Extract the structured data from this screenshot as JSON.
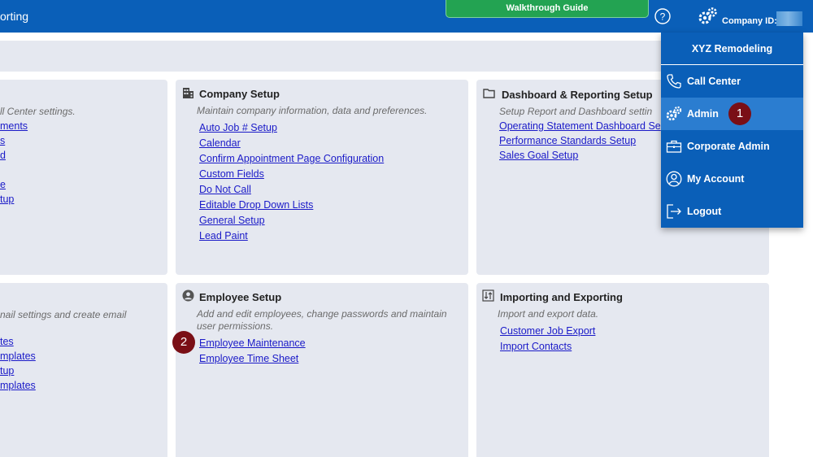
{
  "header": {
    "title_partial": "orting",
    "walkthrough_label": "Walkthrough Guide",
    "company_id_label": "Company ID:"
  },
  "left_cards": {
    "top": {
      "desc_partial": "ll Center settings.",
      "links": [
        "ments",
        "s",
        "d",
        "e",
        "tup"
      ]
    },
    "bottom": {
      "desc_partial": "nail settings and create email",
      "links": [
        "tes",
        "mplates",
        "tup",
        "mplates"
      ]
    }
  },
  "company_setup": {
    "title": "Company Setup",
    "desc": "Maintain company information, data and preferences.",
    "links": [
      "Auto Job # Setup",
      "Calendar",
      "Confirm Appointment Page Configuration",
      "Custom Fields",
      "Do Not Call",
      "Editable Drop Down Lists",
      "General Setup",
      "Lead Paint"
    ]
  },
  "dashboard_setup": {
    "title": "Dashboard & Reporting Setup",
    "desc": "Setup Report and Dashboard settin",
    "links": [
      "Operating Statement Dashboard Se",
      "Performance Standards Setup",
      "Sales Goal Setup"
    ]
  },
  "employee_setup": {
    "title": "Employee Setup",
    "desc_line1": "Add and edit employees, change passwords and maintain",
    "desc_line2": "user permissions.",
    "links": [
      "Employee Maintenance",
      "Employee Time Sheet"
    ]
  },
  "import_export": {
    "title": "Importing and Exporting",
    "desc": "Import and export data.",
    "links": [
      "Customer Job Export",
      "Import Contacts"
    ]
  },
  "dropdown": {
    "company_name": "XYZ Remodeling",
    "items": [
      {
        "label": "Call Center",
        "icon": "phone-icon"
      },
      {
        "label": "Admin",
        "icon": "gears-icon"
      },
      {
        "label": "Corporate Admin",
        "icon": "briefcase-icon"
      },
      {
        "label": "My Account",
        "icon": "user-circle-icon"
      },
      {
        "label": "Logout",
        "icon": "logout-icon"
      }
    ]
  },
  "badges": [
    "1",
    "2"
  ],
  "colors": {
    "header_blue": "#0a5fb8",
    "walkthrough_green": "#23a352",
    "card_bg": "#e5e8f0",
    "link_blue": "#1a1ac8",
    "badge_red": "#7a0f16"
  }
}
